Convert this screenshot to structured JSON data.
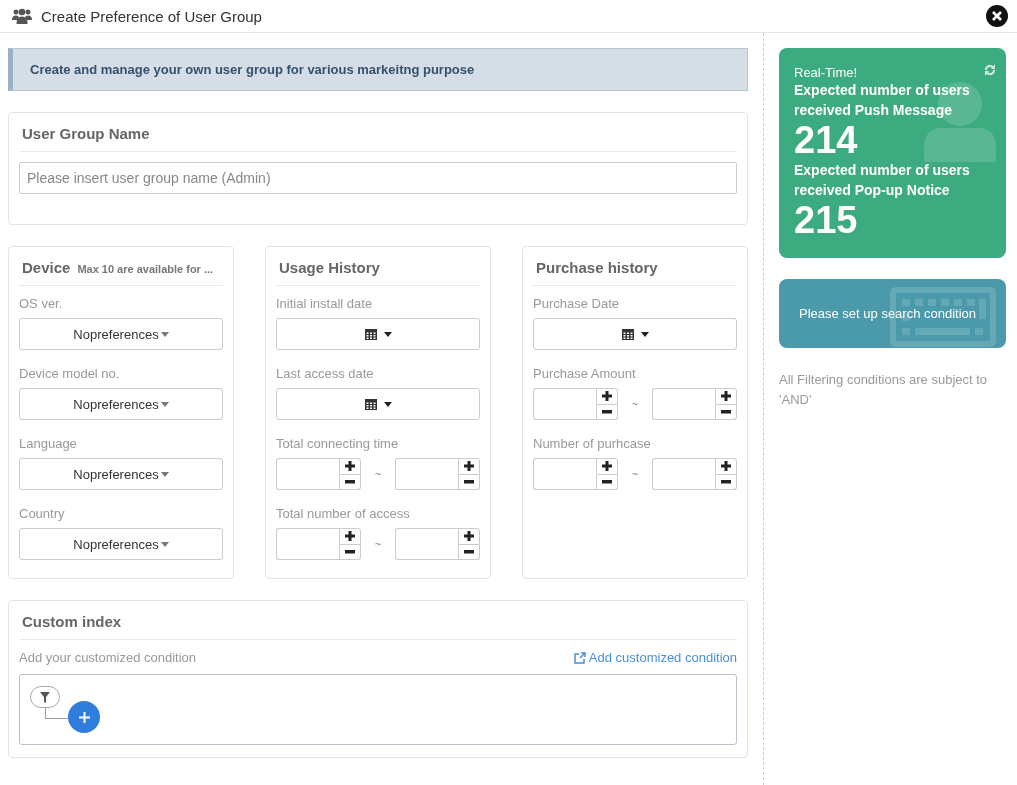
{
  "window": {
    "title": "Create Preference of User Group"
  },
  "banner": "Create and manage your own user group for various markeitng purpose",
  "user_group_name": {
    "title": "User Group Name",
    "placeholder": "Please insert user group name (Admin)"
  },
  "sections": [
    {
      "title": "Device",
      "note": "Max 10 are available for ...",
      "fields": [
        {
          "kind": "dropdown",
          "label": "OS ver.",
          "value": "Nopreferences"
        },
        {
          "kind": "dropdown",
          "label": "Device model no.",
          "value": "Nopreferences"
        },
        {
          "kind": "dropdown",
          "label": "Language",
          "value": "Nopreferences"
        },
        {
          "kind": "dropdown",
          "label": "Country",
          "value": "Nopreferences"
        }
      ]
    },
    {
      "title": "Usage History",
      "fields": [
        {
          "kind": "date",
          "label": "Initial install date"
        },
        {
          "kind": "date",
          "label": "Last access date"
        },
        {
          "kind": "range",
          "label": "Total connecting time",
          "separator": "~"
        },
        {
          "kind": "range",
          "label": "Total number of access",
          "separator": "~"
        }
      ]
    },
    {
      "title": "Purchase history",
      "fields": [
        {
          "kind": "date",
          "label": "Purchase Date"
        },
        {
          "kind": "range",
          "label": "Purchase Amount",
          "separator": "~"
        },
        {
          "kind": "range",
          "label": "Number of purhcase",
          "separator": "~"
        }
      ]
    }
  ],
  "realtime": {
    "heading": "Real-Time!",
    "counts": [
      {
        "label": "Expected number of users received Push Message",
        "value": "214"
      },
      {
        "label": "Expected number of users received Pop-up Notice",
        "value": "215"
      }
    ]
  },
  "search_prompt": "Please set up search condition",
  "filter_note": "All Filtering conditions are subject to 'AND'",
  "custom_index": {
    "title": "Custom index",
    "hint": "Add your customized condition",
    "link": "Add customized condition"
  }
}
